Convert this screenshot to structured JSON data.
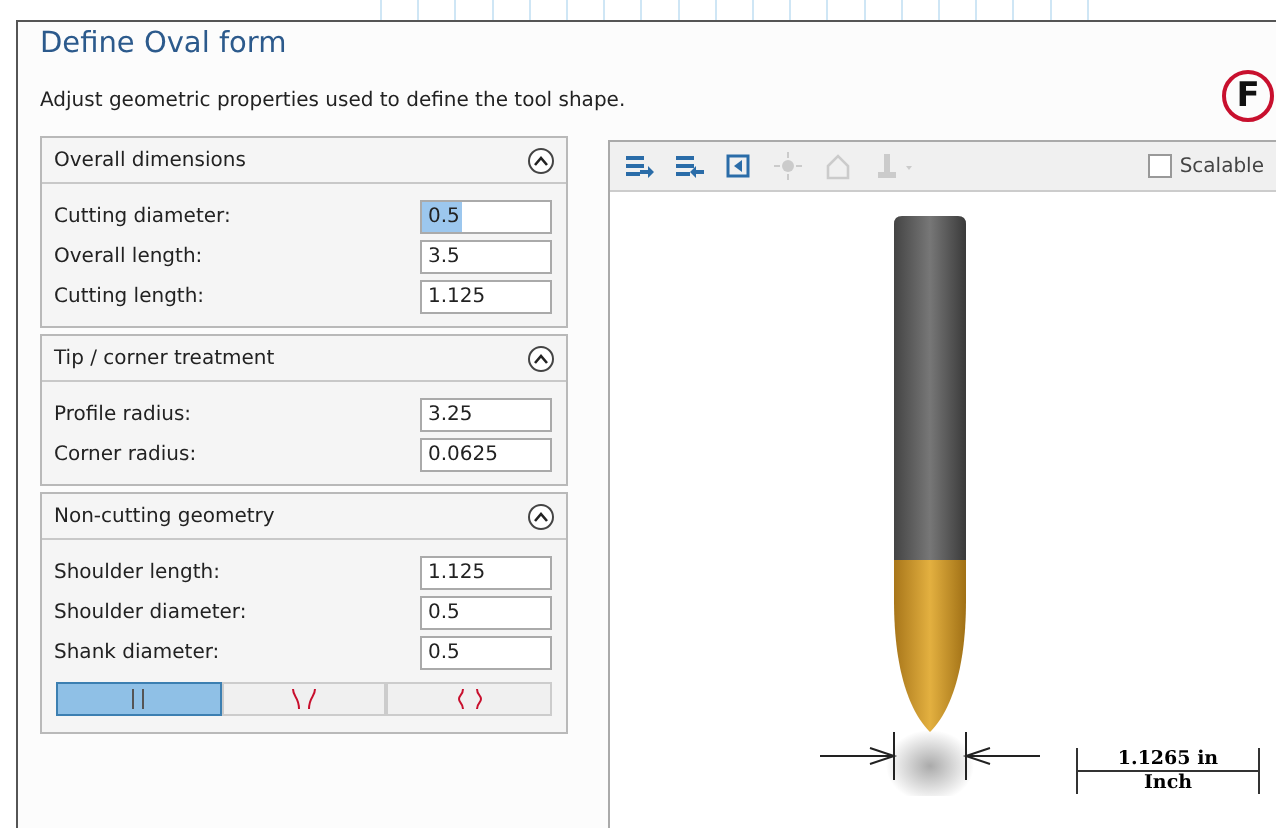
{
  "window": {
    "title": "Define Oval form",
    "description": "Adjust geometric properties used to define the tool shape.",
    "logo_letter": "F"
  },
  "sections": [
    {
      "title": "Overall dimensions",
      "expanded": true,
      "fields": [
        {
          "label": "Cutting diameter:",
          "value": "0.5",
          "selected": true
        },
        {
          "label": "Overall length:",
          "value": "3.5",
          "selected": false
        },
        {
          "label": "Cutting length:",
          "value": "1.125",
          "selected": false
        }
      ]
    },
    {
      "title": "Tip / corner treatment",
      "expanded": true,
      "fields": [
        {
          "label": "Profile radius:",
          "value": "3.25",
          "selected": false
        },
        {
          "label": "Corner radius:",
          "value": "0.0625",
          "selected": false
        }
      ]
    },
    {
      "title": "Non-cutting geometry",
      "expanded": true,
      "fields": [
        {
          "label": "Shoulder length:",
          "value": "1.125",
          "selected": false
        },
        {
          "label": "Shoulder diameter:",
          "value": "0.5",
          "selected": false
        },
        {
          "label": "Shank diameter:",
          "value": "0.5",
          "selected": false
        }
      ],
      "shank_styles": [
        {
          "kind": "straight",
          "selected": true
        },
        {
          "kind": "flared",
          "selected": false
        },
        {
          "kind": "necked",
          "selected": false
        }
      ]
    }
  ],
  "toolbar": [
    {
      "kind": "import",
      "disabled": false
    },
    {
      "kind": "export",
      "disabled": false
    },
    {
      "kind": "reset",
      "disabled": false
    },
    {
      "kind": "light",
      "disabled": true
    },
    {
      "kind": "home",
      "disabled": true
    },
    {
      "kind": "holder",
      "disabled": true
    }
  ],
  "scalable": {
    "label": "Scalable",
    "checked": false
  },
  "preview": {
    "scale_value": "1.1265 in",
    "scale_unit": "Inch"
  }
}
